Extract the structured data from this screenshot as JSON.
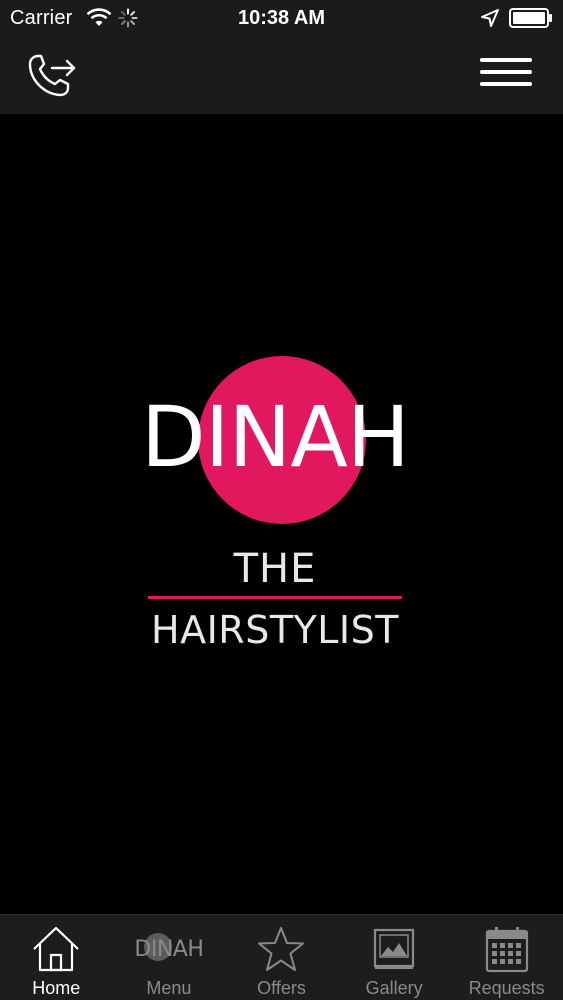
{
  "status_bar": {
    "carrier": "Carrier",
    "time": "10:38 AM",
    "icons": [
      "wifi-icon",
      "activity-spinner-icon",
      "location-arrow-icon",
      "battery-icon"
    ]
  },
  "nav_bar": {
    "left_icon": "phone-call-icon",
    "right_icon": "hamburger-menu-icon"
  },
  "logo": {
    "name": "DINAH",
    "line1": "THE",
    "line2": "HAIRSTYLIST",
    "accent_color": "#e2185e"
  },
  "tab_bar": {
    "tabs": [
      {
        "label": "Home",
        "icon": "home-icon",
        "active": true
      },
      {
        "label": "Menu",
        "icon": "dinah-logo-icon",
        "icon_text": "DINAH",
        "active": false
      },
      {
        "label": "Offers",
        "icon": "star-icon",
        "active": false
      },
      {
        "label": "Gallery",
        "icon": "gallery-image-icon",
        "active": false
      },
      {
        "label": "Requests",
        "icon": "calendar-icon",
        "active": false
      }
    ]
  },
  "colors": {
    "background": "#000000",
    "bars": "#1b1b1b",
    "accent": "#e2185e",
    "tab_inactive": "#8a8a8a",
    "tab_active": "#ffffff"
  }
}
